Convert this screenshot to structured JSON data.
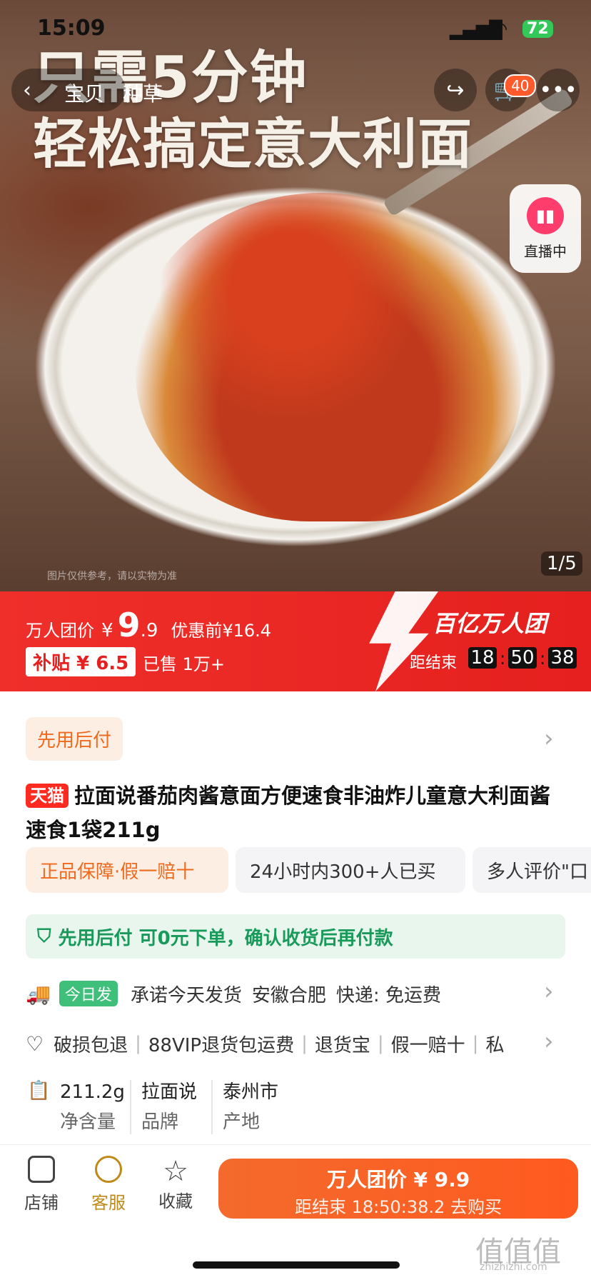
{
  "status": {
    "time": "15:09",
    "battery": "72"
  },
  "hero": {
    "headline1": "只需5分钟",
    "headline2": "轻松搞定意大利面",
    "disclaimer": "图片仅供参考，请以实物为准",
    "pager": "1/5"
  },
  "nav": {
    "tabs": [
      "宝贝",
      "种草"
    ],
    "cart_count": "40",
    "live_label": "直播中"
  },
  "promo": {
    "label": "万人团价",
    "yen": "¥",
    "price_int": "9",
    "price_dec": ".9",
    "orig": "优惠前¥16.4",
    "subsidy": "补贴 ¥ 6.5",
    "sold": "已售 1万+",
    "brand": "百亿万人团",
    "countdown_label": "距结束",
    "hh": "18",
    "mm": "50",
    "ss": "38"
  },
  "pay_later": {
    "tag": "先用后付",
    "notice": "先用后付 可0元下单，确认收货后再付款"
  },
  "product": {
    "badge": "天猫",
    "title": "拉面说番茄肉酱意面方便速食非油炸儿童意大利面酱速食1袋211g"
  },
  "chips": [
    "正品保障·假一赔十",
    "24小时内300+人已买",
    "多人评价\"口"
  ],
  "shipping": {
    "tag": "今日发",
    "text1": "承诺今天发货",
    "text2": "安徽合肥",
    "text3": "快递: 免运费"
  },
  "service": [
    "破损包退",
    "88VIP退货包运费",
    "退货宝",
    "假一赔十",
    "私"
  ],
  "specs": [
    {
      "value": "211.2g",
      "key": "净含量"
    },
    {
      "value": "拉面说",
      "key": "品牌"
    },
    {
      "value": "泰州市",
      "key": "产地"
    }
  ],
  "bottom": {
    "store": "店铺",
    "service": "客服",
    "fav": "收藏",
    "buy_title": "万人团价 ¥ 9.9",
    "buy_sub": "距结束 18:50:38.2 去购买"
  },
  "watermark": {
    "logo": "值值值",
    "url": "zhizhizhi.com"
  },
  "colors": {
    "promo_red": "#e5201e",
    "accent_orange": "#ff5a1f",
    "green": "#1a9a5a"
  }
}
